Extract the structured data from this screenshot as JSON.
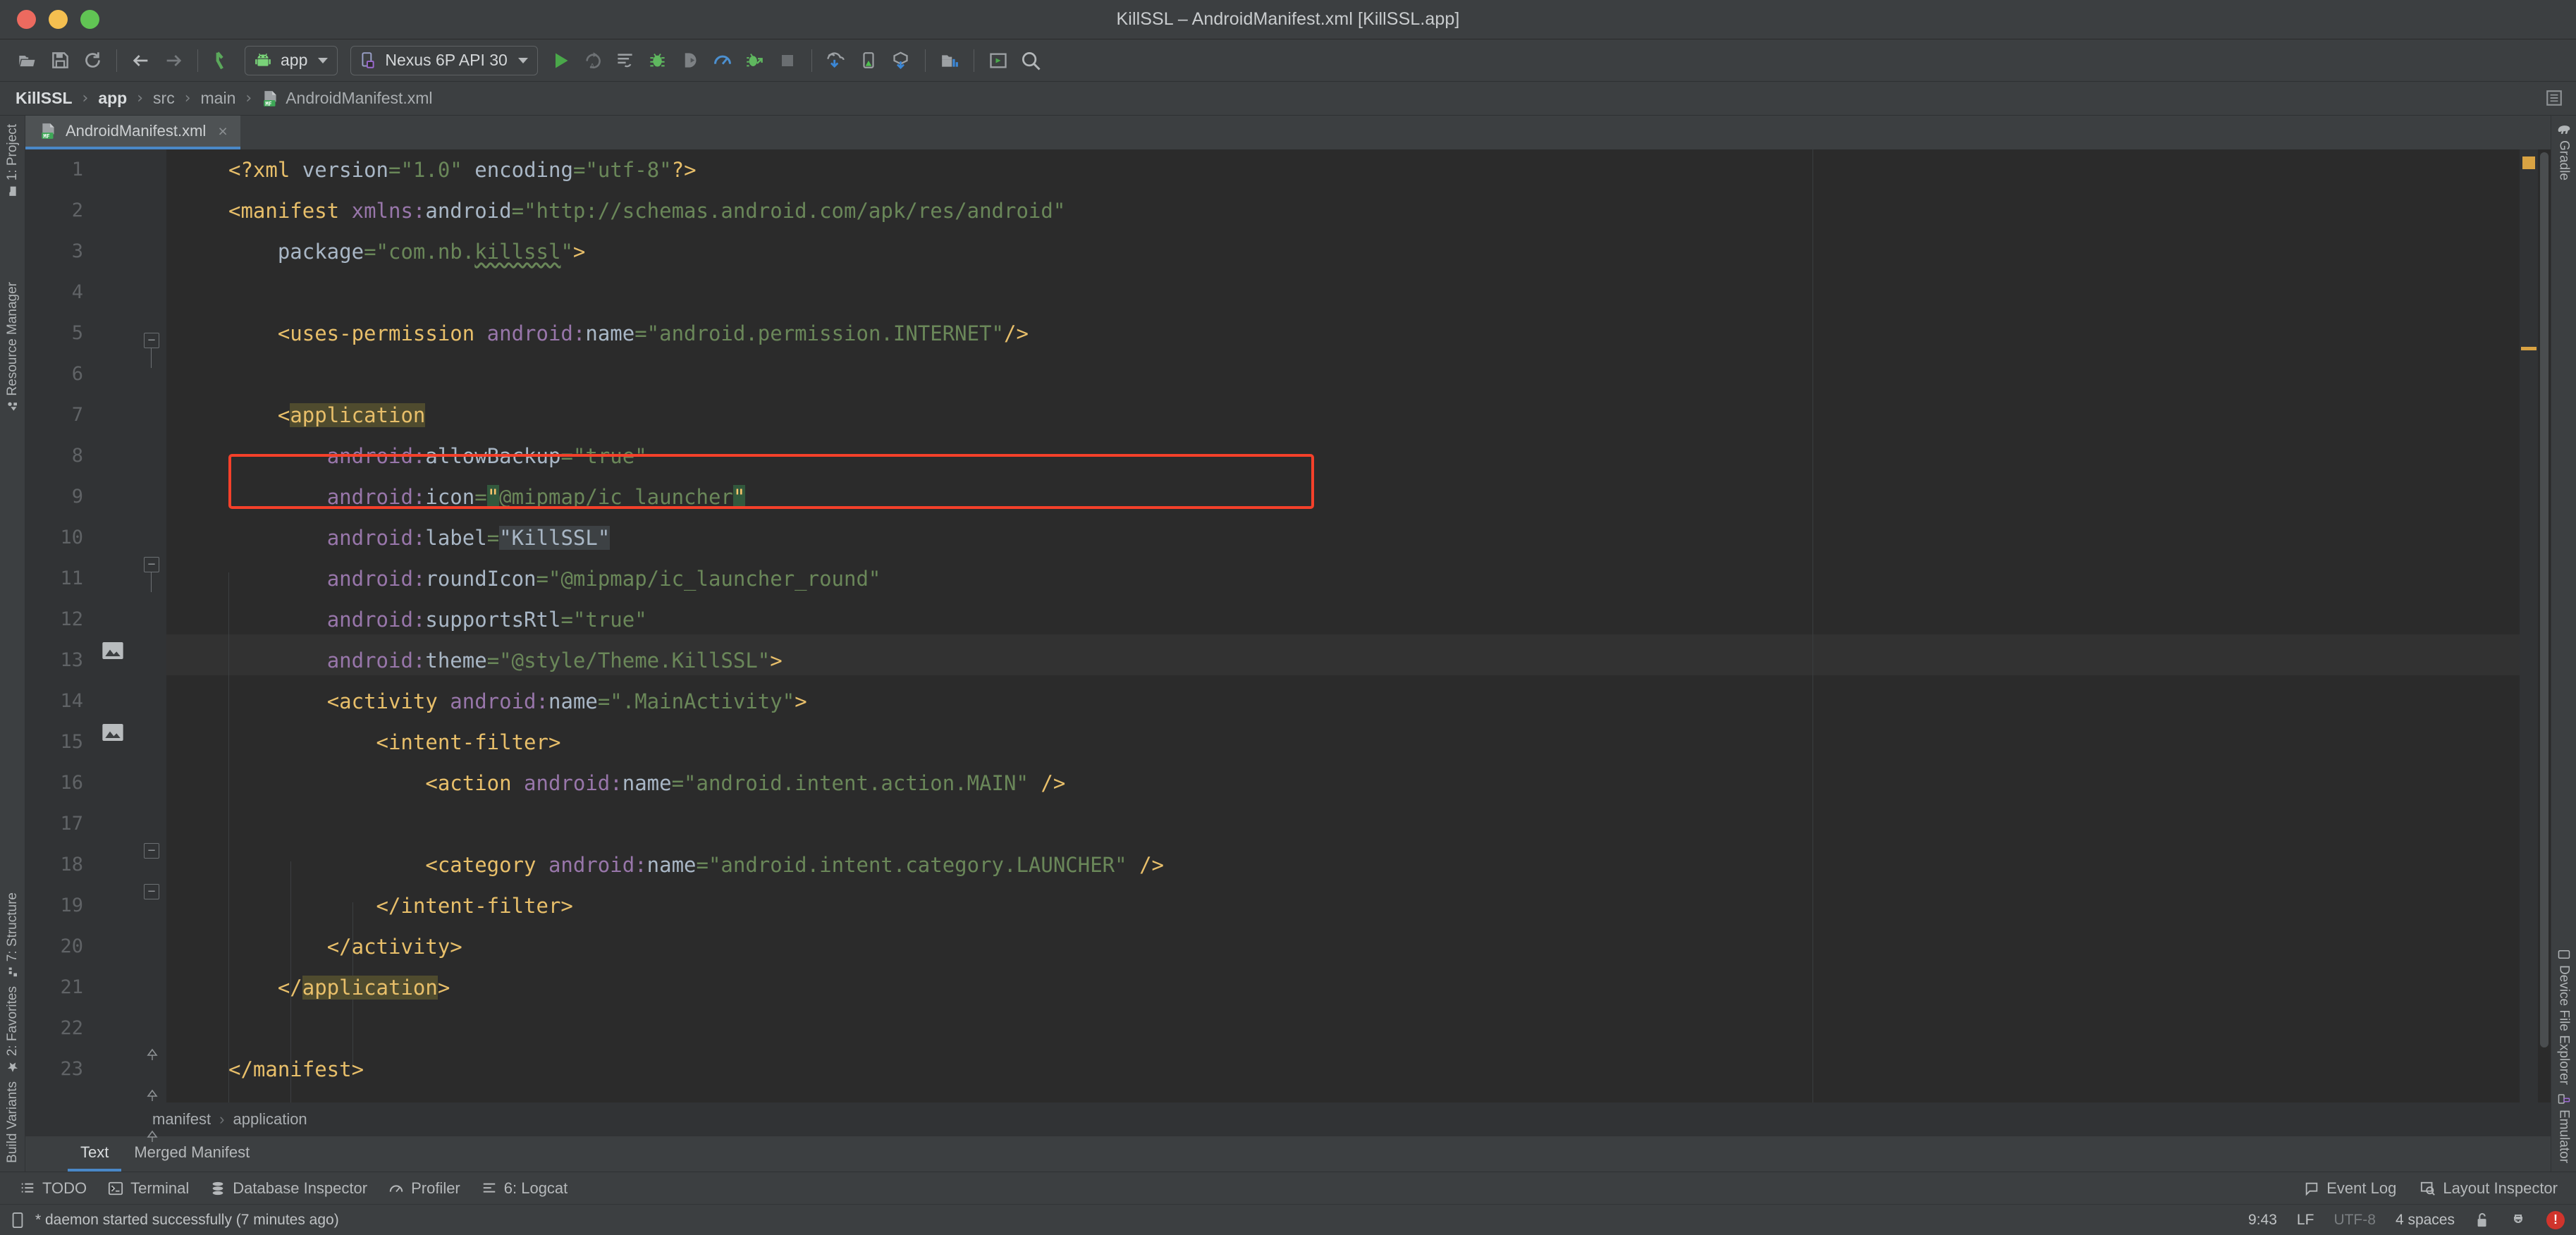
{
  "window": {
    "title": "KillSSL – AndroidManifest.xml [KillSSL.app]",
    "traffic": {
      "close": "close-button",
      "minimize": "minimize-button",
      "zoom": "zoom-button"
    }
  },
  "toolbar": {
    "open_label": "open-folder-icon",
    "save_label": "save-icon",
    "sync_label": "sync-icon",
    "back_label": "back-arrow-icon",
    "forward_label": "forward-arrow-icon",
    "avd_label": "make-project-icon",
    "run_config": "app",
    "device": "Nexus 6P API 30",
    "run_label": "run-icon",
    "rerun_label": "rerun-icon",
    "apply_changes_label": "apply-changes-icon",
    "debug_label": "debug-icon",
    "attach_label": "attach-debugger-icon",
    "profile_label": "profiler-icon",
    "debug_attach_label": "debug-attach-icon",
    "stop_label": "stop-icon",
    "sdk_label": "sdk-manager-icon",
    "avd_manager_label": "avd-manager-icon",
    "device_manager_label": "device-manager-icon",
    "project_structure_label": "project-structure-icon",
    "layout_label": "layout-editor-icon",
    "search_label": "search-icon"
  },
  "breadcrumb": {
    "items": [
      "KillSSL",
      "app",
      "src",
      "main",
      "AndroidManifest.xml"
    ],
    "separator": "›"
  },
  "tabs": [
    {
      "label": "AndroidManifest.xml",
      "icon": "manifest-file-icon",
      "close": "×",
      "active": true
    }
  ],
  "left_strip": {
    "top": [
      {
        "label": "1: Project",
        "underline": "1"
      }
    ],
    "middle": [
      {
        "label": "Resource Manager",
        "underline": ""
      }
    ],
    "bottom": [
      {
        "label": "7: Structure",
        "underline": "7"
      },
      {
        "label": "2: Favorites",
        "underline": "2"
      },
      {
        "label": "Build Variants",
        "underline": ""
      }
    ]
  },
  "right_strip": {
    "top": [
      {
        "label": "Gradle"
      }
    ],
    "bottom": [
      {
        "label": "Device File Explorer"
      },
      {
        "label": "Emulator"
      }
    ]
  },
  "editor": {
    "file_name": "AndroidManifest.xml",
    "gutter_width": 200,
    "lines": [
      {
        "n": 1,
        "indent": 0
      },
      {
        "n": 2,
        "indent": 0
      },
      {
        "n": 3,
        "indent": 0
      },
      {
        "n": 4,
        "indent": 0
      },
      {
        "n": 5,
        "indent": 0
      },
      {
        "n": 6,
        "indent": 0
      },
      {
        "n": 7,
        "indent": 0
      },
      {
        "n": 8,
        "indent": 0
      },
      {
        "n": 9,
        "indent": 0
      },
      {
        "n": 10,
        "indent": 0
      },
      {
        "n": 11,
        "indent": 0
      },
      {
        "n": 12,
        "indent": 0
      },
      {
        "n": 13,
        "indent": 0
      },
      {
        "n": 14,
        "indent": 0
      },
      {
        "n": 15,
        "indent": 0
      },
      {
        "n": 16,
        "indent": 0
      },
      {
        "n": 17,
        "indent": 0
      },
      {
        "n": 18,
        "indent": 0
      },
      {
        "n": 19,
        "indent": 0
      },
      {
        "n": 20,
        "indent": 0
      },
      {
        "n": 21,
        "indent": 0
      },
      {
        "n": 22,
        "indent": 0
      },
      {
        "n": 23,
        "indent": 0
      }
    ],
    "code_text": [
      "<?xml version=\"1.0\" encoding=\"utf-8\"?>",
      "<manifest xmlns:android=\"http://schemas.android.com/apk/res/android\"",
      "    package=\"com.nb.killssl\">",
      "",
      "    <uses-permission android:name=\"android.permission.INTERNET\"/>",
      "",
      "    <application",
      "        android:allowBackup=\"true\"",
      "        android:icon=\"@mipmap/ic_launcher\"",
      "        android:label=\"KillSSL\"",
      "        android:roundIcon=\"@mipmap/ic_launcher_round\"",
      "        android:supportsRtl=\"true\"",
      "        android:theme=\"@style/Theme.KillSSL\">",
      "        <activity android:name=\".MainActivity\">",
      "            <intent-filter>",
      "                <action android:name=\"android.intent.action.MAIN\" />",
      "",
      "                <category android:name=\"android.intent.category.LAUNCHER\" />",
      "            </intent-filter>",
      "        </activity>",
      "    </application>",
      "",
      "</manifest>"
    ],
    "highlight_box": {
      "name": "uses-permission-highlight",
      "line": 5,
      "color": "#f4402a"
    },
    "caret_line": 9,
    "gutter_bulb_line": 9,
    "gutter_image_lines": [
      9,
      11
    ],
    "bottom_breadcrumb": [
      "manifest",
      "application"
    ],
    "bottom_breadcrumb_sep": "›"
  },
  "design_tabs": [
    {
      "label": "Text",
      "active": true
    },
    {
      "label": "Merged Manifest",
      "active": false
    }
  ],
  "bottom_strip": {
    "items": [
      {
        "label": "TODO",
        "icon": "todo-icon",
        "underline": ""
      },
      {
        "label": "Terminal",
        "icon": "terminal-icon",
        "underline": ""
      },
      {
        "label": "Database Inspector",
        "icon": "database-icon",
        "underline": ""
      },
      {
        "label": "Profiler",
        "icon": "profiler-icon",
        "underline": ""
      },
      {
        "label": "6: Logcat",
        "icon": "logcat-icon",
        "underline": "6"
      }
    ],
    "right": [
      {
        "label": "Event Log",
        "icon": "event-log-icon"
      },
      {
        "label": "Layout Inspector",
        "icon": "layout-inspector-icon"
      }
    ]
  },
  "status": {
    "message": "* daemon started successfully (7 minutes ago)",
    "caret_position": "9:43",
    "line_separator": "LF",
    "encoding": "UTF-8",
    "indent": "4 spaces",
    "lock_icon": "unlocked-padlock-icon",
    "inspector_icon": "inspector-hat-icon",
    "error_badge": "!"
  },
  "colors": {
    "accent": "#4a88c7",
    "error": "#f4402a",
    "tag": "#e8bf6a",
    "attr": "#9876aa",
    "value": "#6a8759",
    "text": "#a9b7c6",
    "bg_editor": "#2b2b2b",
    "bg_chrome": "#3c3f41",
    "bg_gutter": "#313335"
  }
}
